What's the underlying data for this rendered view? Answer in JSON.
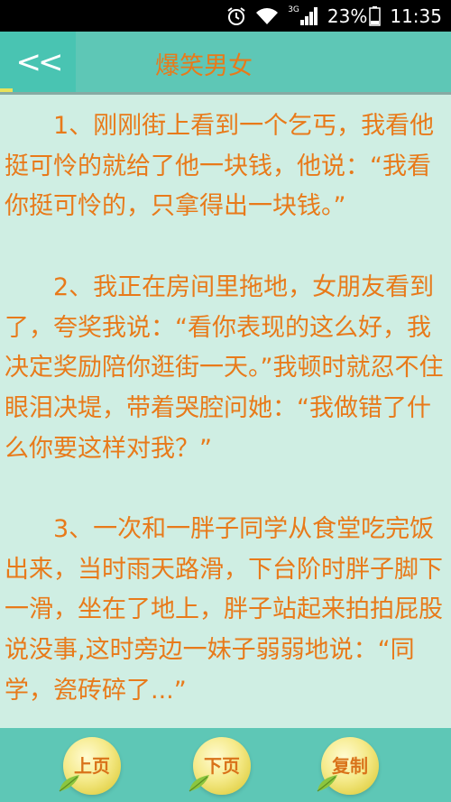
{
  "status_bar": {
    "network": "3G",
    "battery": "23%",
    "time": "11:35"
  },
  "header": {
    "back_label": "<<",
    "title": "爆笑男女"
  },
  "content": {
    "jokes": [
      "1、刚刚街上看到一个乞丐，我看他挺可怜的就给了他一块钱，他说：“我看你挺可怜的，只拿得出一块钱。”",
      "2、我正在房间里拖地，女朋友看到了，夸奖我说：“看你表现的这么好，我决定奖励陪你逛街一天。”我顿时就忍不住眼泪决堤，带着哭腔问她：“我做错了什么你要这样对我？”",
      "3、一次和一胖子同学从食堂吃完饭出来，当时雨天路滑，下台阶时胖子脚下一滑，坐在了地上，胖子站起来拍拍屁股说没事,这时旁边一妹子弱弱地说：“同学，瓷砖碎了...”"
    ]
  },
  "bottom": {
    "prev_label": "上页",
    "next_label": "下页",
    "copy_label": "复制"
  },
  "colors": {
    "background": "#cfeee3",
    "header": "#5ec7b6",
    "text": "#e87a1a"
  }
}
